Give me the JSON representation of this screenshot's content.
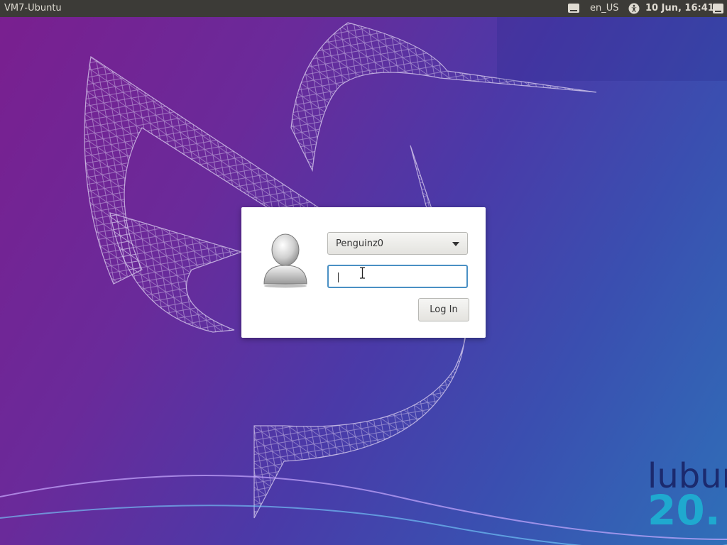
{
  "top_panel": {
    "hostname": "VM7-Ubuntu",
    "locale": "en_US",
    "clock": "10 Jun, 16:41",
    "icons": [
      "keyboard-icon",
      "accessibility-icon",
      "session-icon"
    ]
  },
  "login": {
    "selected_user": "Penguinz0",
    "password_value": "",
    "login_button_label": "Log In",
    "focus_color": "#4a90c4"
  },
  "branding": {
    "name": "lubun",
    "version": "20."
  },
  "colors": {
    "panel_bg": "#3c3b37",
    "wallpaper_start": "#7a1f8f",
    "wallpaper_end": "#2f6fb8",
    "brand_version": "#1fa9cf"
  }
}
